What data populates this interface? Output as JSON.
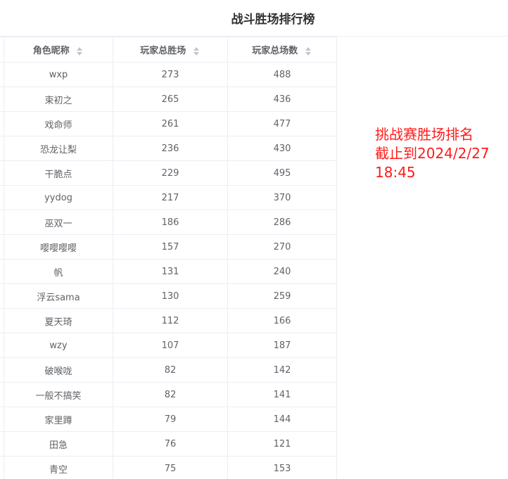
{
  "page": {
    "title": "战斗胜场排行榜"
  },
  "table": {
    "headers": [
      "角色昵称",
      "玩家总胜场",
      "玩家总场数"
    ],
    "rows": [
      [
        "wxp",
        "273",
        "488"
      ],
      [
        "束初之",
        "265",
        "436"
      ],
      [
        "戏命师",
        "261",
        "477"
      ],
      [
        "恐龙让梨",
        "236",
        "430"
      ],
      [
        "干脆点",
        "229",
        "495"
      ],
      [
        "yydog",
        "217",
        "370"
      ],
      [
        "巫双一",
        "186",
        "286"
      ],
      [
        "嘤嘤嘤嘤",
        "157",
        "270"
      ],
      [
        "帆",
        "131",
        "240"
      ],
      [
        "浮云sama",
        "130",
        "259"
      ],
      [
        "夏天琦",
        "112",
        "166"
      ],
      [
        "wzy",
        "107",
        "187"
      ],
      [
        "破喉咙",
        "82",
        "142"
      ],
      [
        "一般不搞笑",
        "82",
        "141"
      ],
      [
        "家里蹲",
        "79",
        "144"
      ],
      [
        "田急",
        "76",
        "121"
      ],
      [
        "青空",
        "75",
        "153"
      ]
    ]
  },
  "annotation": {
    "line1": "挑战赛胜场排名",
    "line2": "截止到2024/2/27",
    "line3": "18:45"
  },
  "colors": {
    "annotation": "#ff1a1a",
    "border": "#ebeef5",
    "text": "#606266",
    "title": "#303133"
  }
}
